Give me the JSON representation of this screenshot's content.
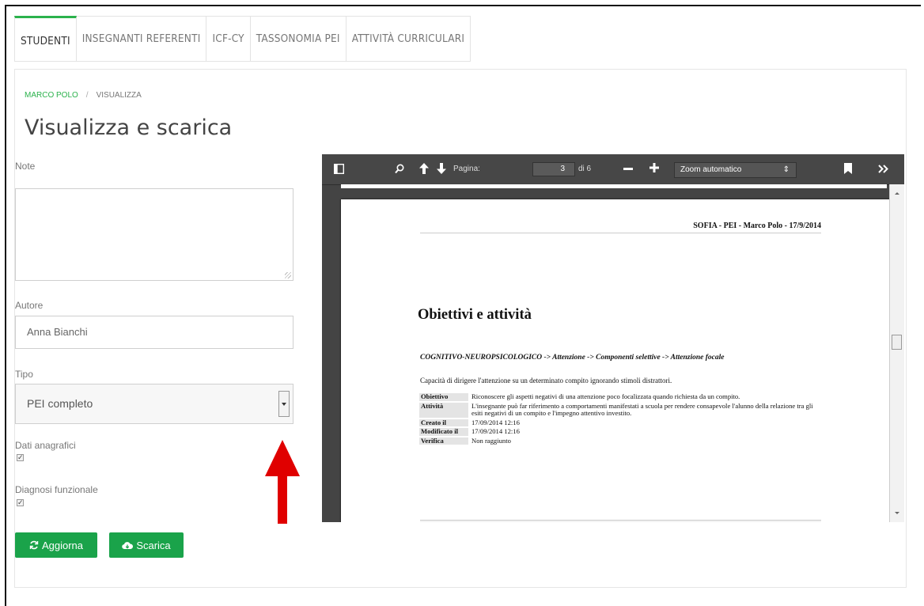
{
  "tabs": [
    "STUDENTI",
    "INSEGNANTI REFERENTI",
    "ICF-CY",
    "TASSONOMIA PEI",
    "ATTIVITÀ CURRICULARI"
  ],
  "breadcrumb": {
    "student": "MARCO POLO",
    "current": "VISUALIZZA"
  },
  "page_title": "Visualizza e scarica",
  "form": {
    "note_label": "Note",
    "note_value": "",
    "author_label": "Autore",
    "author_value": "Anna Bianchi",
    "type_label": "Tipo",
    "type_value": "PEI completo",
    "dati_label": "Dati anagrafici",
    "dati_checked": true,
    "diagnosi_label": "Diagnosi funzionale",
    "diagnosi_checked": true
  },
  "buttons": {
    "update": "Aggiorna",
    "download": "Scarica"
  },
  "accent_color": "#2bb24c",
  "button_color": "#1aa34a",
  "arrow_color": "#e00000",
  "viewer": {
    "page_label": "Pagina:",
    "page_value": "3",
    "page_total": "di 6",
    "zoom_value": "Zoom automatico",
    "doc": {
      "header": "SOFIA - PEI - Marco Polo - 17/9/2014",
      "heading": "Obiettivi e attività",
      "path": "COGNITIVO-NEUROPSICOLOGICO -> Attenzione -> Componenti selettive -> Attenzione focale",
      "description": "Capacità di dirigere l'attenzione su un determinato compito ignorando stimoli distrattori.",
      "rows": [
        {
          "key": "Obiettivo",
          "value": "Riconoscere gli aspetti negativi di una attenzione poco focalizzata quando richiesta da un compito."
        },
        {
          "key": "Attività",
          "value": "L'insegnante può far riferimento a comportamenti manifestati a scuola per rendere consapevole l'alunno della relazione tra gli esiti negativi di un compito e l'impegno attentivo investito."
        },
        {
          "key": "Creato il",
          "value": "17/09/2014 12:16"
        },
        {
          "key": "Modificato il",
          "value": "17/09/2014 12:16"
        },
        {
          "key": "Verifica",
          "value": "Non raggiunto"
        }
      ]
    }
  }
}
